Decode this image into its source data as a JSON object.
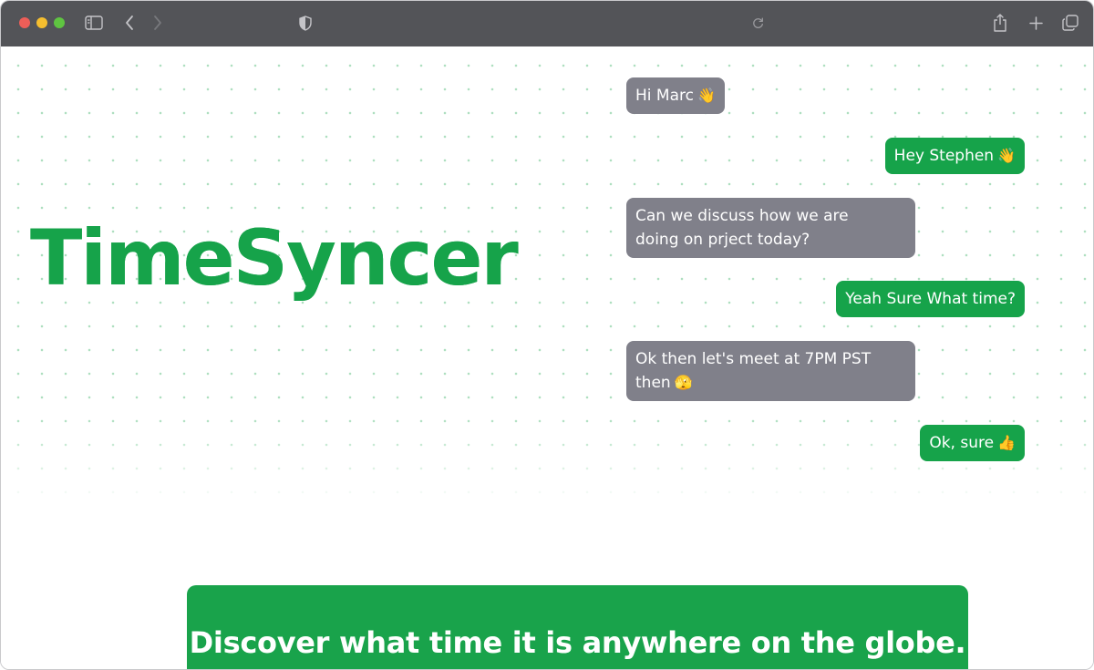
{
  "browser": {
    "toolbar_icons": [
      "sidebar-icon",
      "back-icon",
      "forward-icon",
      "privacy-shield-icon",
      "reload-icon",
      "share-icon",
      "new-tab-icon",
      "tabs-overview-icon"
    ]
  },
  "hero": {
    "title": "TimeSyncer",
    "accent_color": "#16a34a"
  },
  "chat": {
    "incoming_color": "#80808a",
    "outgoing_color": "#16a34a",
    "messages": [
      {
        "side": "incoming",
        "text": "Hi Marc",
        "emoji": "👋"
      },
      {
        "side": "outgoing",
        "text": "Hey Stephen",
        "emoji": "👋"
      },
      {
        "side": "incoming",
        "line1": "Can we discuss how we are",
        "line2": "doing on prject today?"
      },
      {
        "side": "outgoing",
        "text": "Yeah Sure What time?"
      },
      {
        "side": "incoming",
        "line1": "Ok then let's meet at 7PM PST",
        "line2": "then",
        "emoji": "🫣"
      },
      {
        "side": "outgoing",
        "text": "Ok, sure",
        "emoji": "👍"
      }
    ]
  },
  "banner": {
    "text": "Discover what time it is anywhere on the globe."
  }
}
